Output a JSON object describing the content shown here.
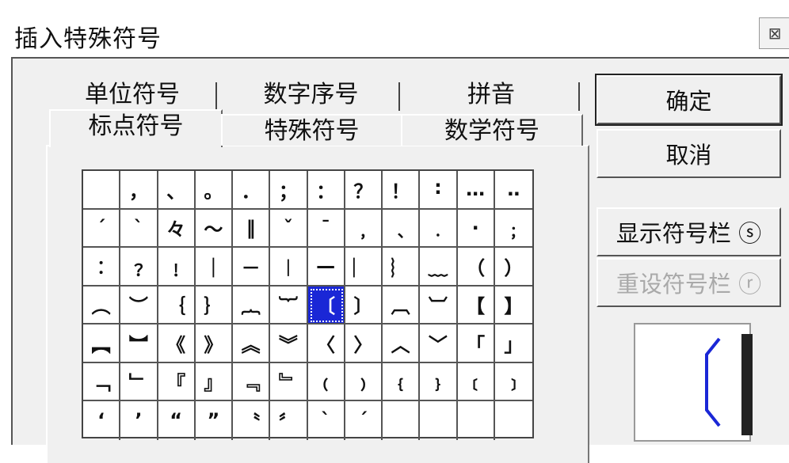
{
  "window": {
    "title": "插入特殊符号",
    "close_symbol": "⊠"
  },
  "tabs": {
    "back_row": [
      "单位符号",
      "数字序号",
      "拼音"
    ],
    "front_row": [
      "标点符号",
      "特殊符号",
      "数学符号"
    ],
    "active": "标点符号"
  },
  "symbols": [
    [
      "",
      "，",
      "、",
      "。",
      "．",
      "；",
      "：",
      "？",
      "！",
      "∶",
      "…",
      "‥"
    ],
    [
      "ˊ",
      "ˋ",
      "々",
      "～",
      "‖",
      "ˇ",
      "ˉ",
      "﹐",
      "﹑",
      "﹒",
      "·",
      "﹔"
    ],
    [
      "︰",
      "﹖",
      "﹗",
      "｜",
      "－",
      "︱",
      "—",
      "︳",
      "︴",
      "﹏",
      "（",
      "）"
    ],
    [
      "︵",
      "︶",
      "｛",
      "｝",
      "︷",
      "︸",
      "〔",
      "〕",
      "︹",
      "︺",
      "【",
      "】"
    ],
    [
      "︻",
      "︼",
      "《",
      "》",
      "︽",
      "︾",
      "〈",
      "〉",
      "︿",
      "﹀",
      "「",
      "」"
    ],
    [
      "﹁",
      "﹂",
      "『",
      "』",
      "﹃",
      "﹄",
      "﹙",
      "﹚",
      "﹛",
      "﹜",
      "﹝",
      "﹞"
    ],
    [
      "‘",
      "’",
      "“",
      "”",
      "〝",
      "〞",
      "ˋ",
      "ˊ",
      "",
      "",
      "",
      ""
    ]
  ],
  "selected": {
    "row": 3,
    "col": 6
  },
  "buttons": {
    "ok": "确定",
    "cancel": "取消",
    "show_bar": "显示符号栏 ⓢ",
    "reset_bar": "重设符号栏 ⓡ"
  },
  "preview": {
    "glyph": "〔"
  },
  "colors": {
    "selection": "#1a27d6"
  }
}
